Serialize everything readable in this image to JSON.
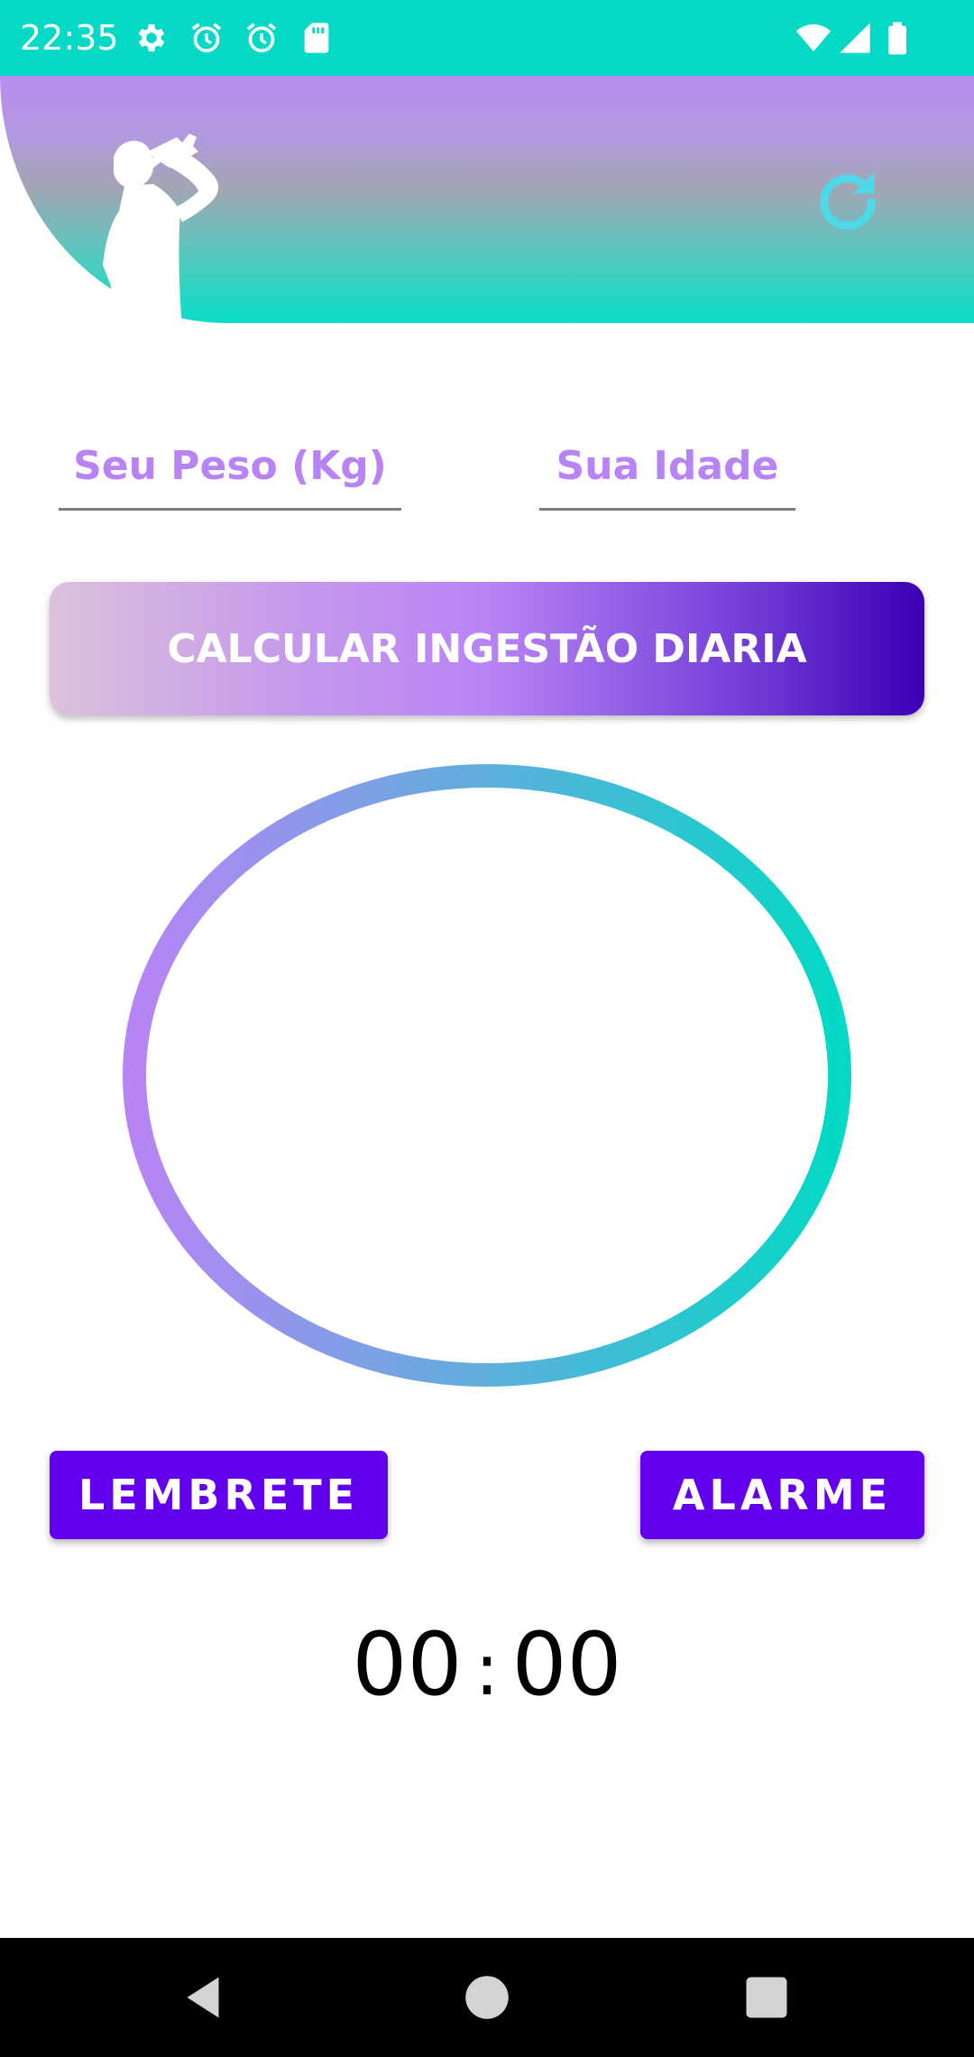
{
  "status_bar": {
    "time": "22:35",
    "left_icons": [
      "gear-icon",
      "alarm-icon",
      "alarm-icon",
      "sd-card-icon"
    ],
    "right_icons": [
      "wifi-icon",
      "signal-icon",
      "battery-icon"
    ],
    "background": "#03d9c5"
  },
  "header": {
    "icons": [
      "drinking-person-silhouette",
      "refresh-icon"
    ],
    "gradient": [
      "#b98cf0",
      "#a3a5b3",
      "#09dcc8"
    ]
  },
  "form": {
    "weight_placeholder": "Seu Peso (Kg)",
    "weight_value": "",
    "age_placeholder": "Sua Idade",
    "age_value": ""
  },
  "calculate_button": {
    "label": "CALCULAR INGESTÃO DIARIA",
    "gradient": [
      "#dcc2dc",
      "#b884f5",
      "#3b00b4"
    ]
  },
  "progress_ring": {
    "colors": [
      "#b884f5",
      "#03d9c5"
    ]
  },
  "actions": {
    "lembrete_label": "LEMBRETE",
    "alarme_label": "ALARME",
    "color": "#6200ee"
  },
  "timer": {
    "hours": "00",
    "separator": ":",
    "minutes": "00"
  },
  "nav_bar": {
    "buttons": [
      "back-icon",
      "home-icon",
      "recents-icon"
    ]
  }
}
